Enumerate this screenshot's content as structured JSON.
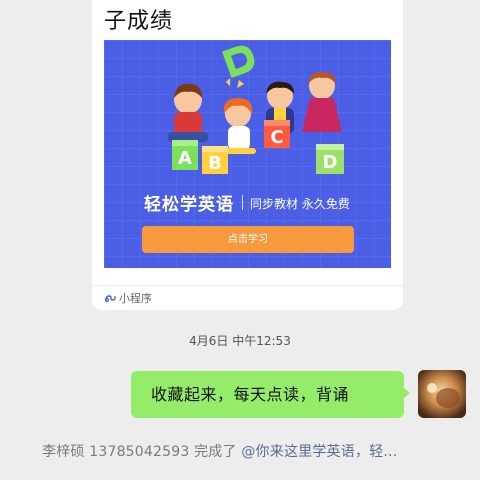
{
  "card": {
    "title": "子成绩",
    "banner": {
      "letters": [
        "A",
        "B",
        "C",
        "D",
        "D"
      ],
      "title": "轻松学英语",
      "subtitle": "同步教材 永久免费",
      "cta_label": "点击学习"
    },
    "mini_program_label": "小程序"
  },
  "chat": {
    "timestamp": "4月6日 中午12:53",
    "outgoing_message": "收藏起来，每天点读，背诵",
    "notice_prefix": "李梓硕 13785042593 完成了 ",
    "notice_mention": "@你来这里学英语，轻..."
  },
  "colors": {
    "chat_background": "#ededed",
    "bubble_green": "#95ec69",
    "banner_blue": "#4a5ee6",
    "cta_orange": "#f79a3e"
  },
  "icons": [
    "mini-program-icon",
    "avatar"
  ]
}
